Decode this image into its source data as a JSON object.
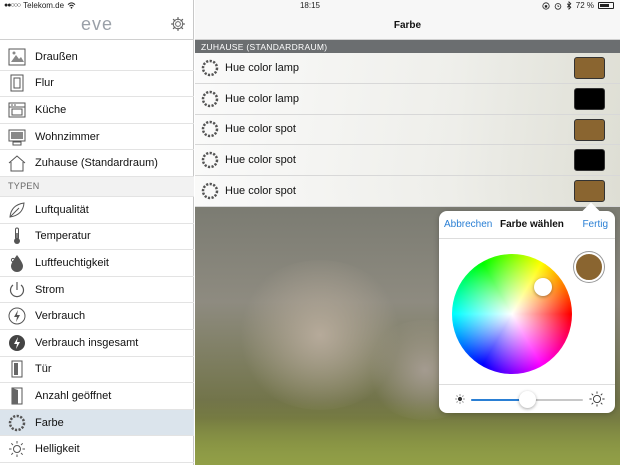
{
  "status": {
    "carrier": "Telekom.de",
    "time": "18:15",
    "battery": "72 %"
  },
  "sidebar": {
    "logo": "eve",
    "rooms": [
      {
        "label": "Draußen",
        "icon": "outdoor-icon"
      },
      {
        "label": "Flur",
        "icon": "door-icon"
      },
      {
        "label": "Küche",
        "icon": "oven-icon"
      },
      {
        "label": "Wohnzimmer",
        "icon": "tv-icon"
      },
      {
        "label": "Zuhause (Standardraum)",
        "icon": "house-icon"
      }
    ],
    "types_header": "TYPEN",
    "types": [
      {
        "label": "Luftqualität",
        "icon": "leaf-icon"
      },
      {
        "label": "Temperatur",
        "icon": "thermometer-icon"
      },
      {
        "label": "Luftfeuchtigkeit",
        "icon": "droplet-icon"
      },
      {
        "label": "Strom",
        "icon": "power-icon"
      },
      {
        "label": "Verbrauch",
        "icon": "bolt-icon"
      },
      {
        "label": "Verbrauch insgesamt",
        "icon": "bolt-filled-icon"
      },
      {
        "label": "Tür",
        "icon": "door-sensor-icon"
      },
      {
        "label": "Anzahl geöffnet",
        "icon": "door-open-icon"
      },
      {
        "label": "Farbe",
        "icon": "color-ring-icon",
        "active": true
      },
      {
        "label": "Helligkeit",
        "icon": "sun-icon"
      }
    ]
  },
  "main": {
    "title": "Farbe",
    "room_header": "ZUHAUSE (STANDARDRAUM)",
    "devices": [
      {
        "label": "Hue color lamp",
        "color": "#8a6530"
      },
      {
        "label": "Hue color lamp",
        "color": "#000000"
      },
      {
        "label": "Hue color spot",
        "color": "#8a6530"
      },
      {
        "label": "Hue color spot",
        "color": "#000000"
      },
      {
        "label": "Hue color spot",
        "color": "#8a6530"
      }
    ]
  },
  "popover": {
    "cancel": "Abbrechen",
    "title": "Farbe wählen",
    "done": "Fertig",
    "selected_color": "#8a6530",
    "brightness": 0.5
  },
  "colors": {
    "accent": "#2a7fd4",
    "active_row": "#dbe4ec",
    "section_header": "#6b6e70"
  }
}
